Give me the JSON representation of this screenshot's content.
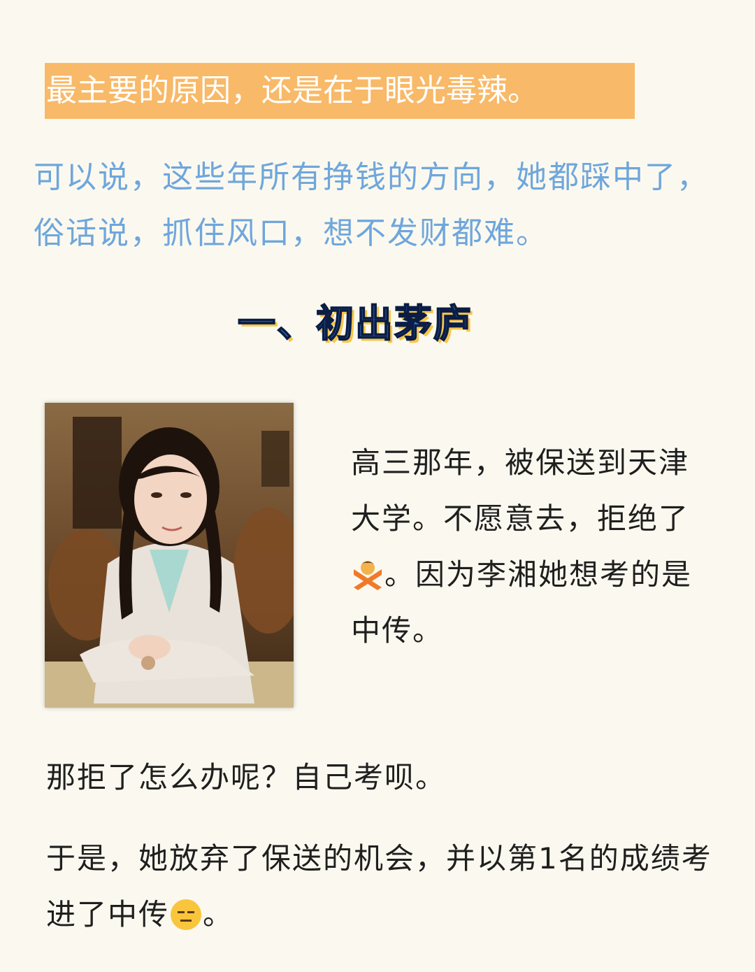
{
  "highlight": {
    "text": "最主要的原因，还是在于眼光毒辣。",
    "color": "#f8b968"
  },
  "intro": {
    "text": "可以说，这些年所有挣钱的方向，她都踩中了，俗话说，抓住风口，想不发财都难。",
    "color": "#6fa6dc"
  },
  "section": {
    "heading": "一、初出茅庐"
  },
  "photo": {
    "subject": "portrait photo of a young woman with pigtails in a light cardigan, seated at a table"
  },
  "side_text": {
    "part1": "高三那年，被保送到天津大学。不愿意去，拒绝了",
    "emoji1": "person-gesturing-no-icon",
    "part2": "。因为李湘她想考的是中传。"
  },
  "paragraphs": {
    "p1": "那拒了怎么办呢？自己考呗。",
    "p2_text": "于是，她放弃了保送的机会，并以第1名的成绩考进了中传",
    "p2_emoji": "expressionless-face-icon",
    "p2_end": "。"
  }
}
